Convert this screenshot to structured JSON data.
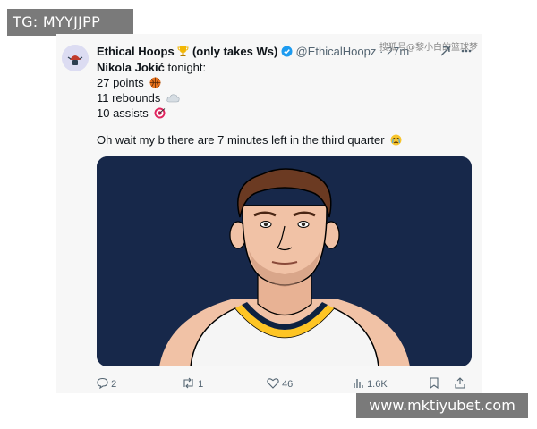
{
  "watermarks": {
    "top_left": "TG: MYYJJPP",
    "bottom_right": "www.mktiyubet.com"
  },
  "tweet": {
    "author_name": "Ethical Hoops",
    "author_suffix": "(only takes Ws)",
    "handle": "@EthicalHoopz · 27m",
    "source_watermark": "搜狐号@黎小白的篮球梦",
    "lines": [
      {
        "text": "Nikola Jokić",
        "suffix": " tonight:"
      },
      {
        "text": "27 points",
        "emoji": "basketball-icon"
      },
      {
        "text": "11 rebounds",
        "emoji": "cloud-icon"
      },
      {
        "text": "10 assists",
        "emoji": "target-icon"
      }
    ],
    "followup": "Oh wait my b there are 7 minutes left in the third quarter",
    "followup_emoji": "crying-face-icon",
    "media_alt_icon": "player-portrait-illustration"
  },
  "actions": {
    "replies": "2",
    "retweets": "1",
    "likes": "46",
    "views": "1.6K"
  },
  "colors": {
    "media_background": "#17284a",
    "jersey_gold": "#fec524",
    "text_secondary": "#536471",
    "verified_blue": "#1d9bf0"
  }
}
